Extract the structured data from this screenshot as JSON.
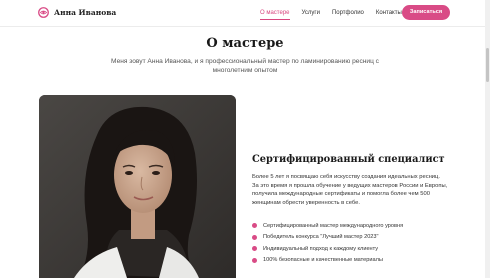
{
  "header": {
    "logo_text": "Анна Иванова",
    "logo_icon": "eye-icon",
    "nav": [
      {
        "label": "О мастере",
        "active": true
      },
      {
        "label": "Услуги",
        "active": false
      },
      {
        "label": "Портфолио",
        "active": false
      },
      {
        "label": "Контакты",
        "active": false
      }
    ],
    "cta_label": "Записаться"
  },
  "hero": {
    "title": "О мастере",
    "subtitle": "Меня зовут Анна Иванова, и я профессиональный мастер по ламинированию ресниц с многолетним опытом"
  },
  "about": {
    "title": "Сертифицированный специалист",
    "paragraph": "Более 5 лет я посвящаю себя искусству создания идеальных ресниц. За это время я прошла обучение у ведущих мастеров России и Европы, получила международные сертификаты и помогла более чем 500 женщинам обрести уверенность в себе.",
    "features": [
      "Сертифицированный мастер международного уровня",
      "Победитель конкурса \"Лучший мастер 2023\"",
      "Индивидуальный подход к каждому клиенту",
      "100% безопасные и качественные материалы"
    ]
  },
  "colors": {
    "accent": "#d94b86",
    "text": "#222222",
    "muted": "#555555"
  }
}
